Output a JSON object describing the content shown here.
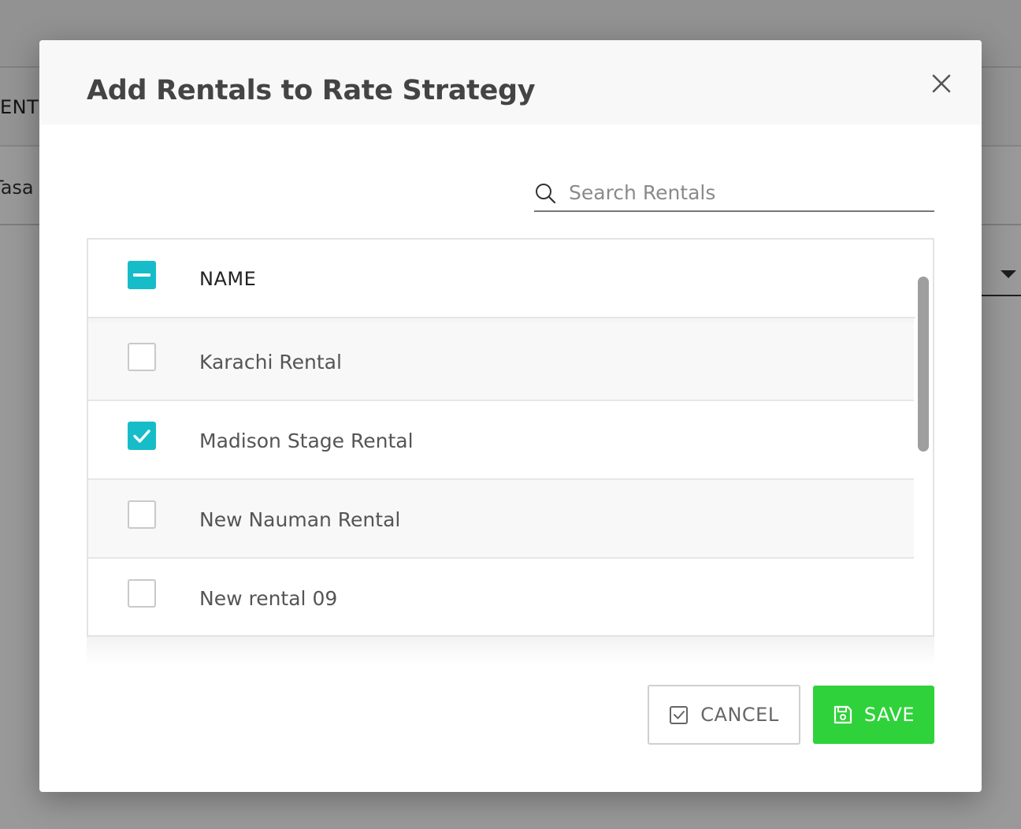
{
  "background": {
    "row1_text": "ENT",
    "row2_text": "Tasa"
  },
  "modal": {
    "title": "Add Rentals to Rate Strategy",
    "close_icon": "close-icon"
  },
  "search": {
    "placeholder": "Search Rentals",
    "value": "",
    "icon": "search-icon"
  },
  "table": {
    "column_header": "NAME",
    "select_all_state": "indeterminate",
    "rows": [
      {
        "name": "Karachi Rental",
        "checked": false
      },
      {
        "name": "Madison Stage Rental",
        "checked": true
      },
      {
        "name": "New Nauman Rental",
        "checked": false
      },
      {
        "name": "New rental 09",
        "checked": false
      }
    ]
  },
  "buttons": {
    "cancel_label": "CANCEL",
    "cancel_icon": "checkbox-icon",
    "save_label": "SAVE",
    "save_icon": "floppy-disk-icon"
  },
  "colors": {
    "accent": "#17bcc9",
    "save": "#2fd23a"
  }
}
